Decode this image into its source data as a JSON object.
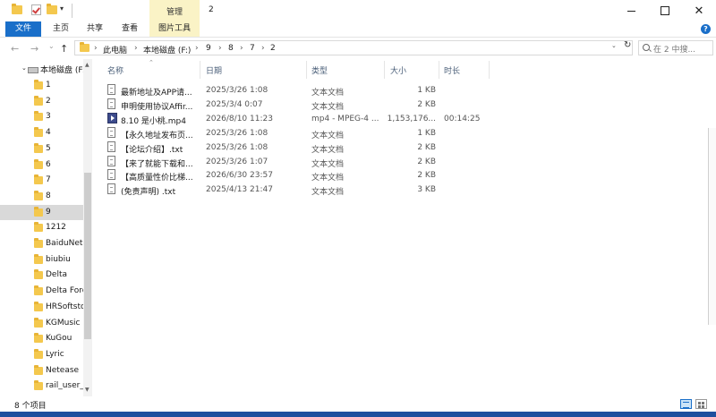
{
  "window": {
    "title": "2",
    "manage_tab_label": "管理",
    "min_icon": "minimize-icon",
    "max_icon": "maximize-icon",
    "close_glyph": "✕"
  },
  "quick_access": {
    "dropdown_glyph": "▾"
  },
  "ribbon": {
    "tabs": [
      "文件",
      "主页",
      "共享",
      "查看",
      "图片工具"
    ],
    "help_glyph": "?",
    "accent_color": "#1a6fc9",
    "manage_color": "#faf3c6"
  },
  "address": {
    "back_glyph": "←",
    "forward_glyph": "→",
    "recent_glyph": "⌄",
    "up_glyph": "↑",
    "breadcrumbs": [
      "此电脑",
      "本地磁盘 (F:)",
      "9",
      "8",
      "7",
      "2"
    ],
    "separator": "›",
    "dropdown_glyph": "⌄",
    "refresh_glyph": "↻",
    "search_placeholder": "在 2 中搜..."
  },
  "sidebar": {
    "drive_label": "本地磁盘 (F:)",
    "drive_chevron": "⌄",
    "items": [
      "1",
      "2",
      "3",
      "4",
      "5",
      "6",
      "7",
      "8",
      "9",
      "1212",
      "BaiduNetdisk",
      "biubiu",
      "Delta",
      "Delta Force",
      "HRSoftstore",
      "KGMusic",
      "KuGou",
      "Lyric",
      "Netease",
      "rail_user_data"
    ],
    "selected_index": 8,
    "scroll_up_glyph": "▲",
    "scroll_down_glyph": "▼"
  },
  "filelist": {
    "sort_glyph": "⌃",
    "columns": {
      "name": "名称",
      "date": "日期",
      "type": "类型",
      "size": "大小",
      "length": "时长"
    },
    "rows": [
      {
        "name": "最新地址及APP请...",
        "date": "2025/3/26 1:08",
        "type": "文本文档",
        "size": "1 KB",
        "length": "",
        "icon": "text-doc-icon"
      },
      {
        "name": "申明使用协议Affir...",
        "date": "2025/3/4 0:07",
        "type": "文本文档",
        "size": "2 KB",
        "length": "",
        "icon": "text-doc-icon"
      },
      {
        "name": "8.10 是小桃.mp4",
        "date": "2026/8/10 11:23",
        "type": "mp4 - MPEG-4 ...",
        "size": "1,153,176...",
        "length": "00:14:25",
        "icon": "video-file-icon"
      },
      {
        "name": "【永久地址发布页...",
        "date": "2025/3/26 1:08",
        "type": "文本文档",
        "size": "1 KB",
        "length": "",
        "icon": "text-doc-icon"
      },
      {
        "name": "【论坛介绍】.txt",
        "date": "2025/3/26 1:08",
        "type": "文本文档",
        "size": "2 KB",
        "length": "",
        "icon": "text-doc-icon"
      },
      {
        "name": "【来了就能下载和...",
        "date": "2025/3/26 1:07",
        "type": "文本文档",
        "size": "2 KB",
        "length": "",
        "icon": "text-doc-icon"
      },
      {
        "name": "【高质量性价比梯...",
        "date": "2026/6/30 23:57",
        "type": "文本文档",
        "size": "2 KB",
        "length": "",
        "icon": "text-doc-icon"
      },
      {
        "name": "(免责声明) .txt",
        "date": "2025/4/13 21:47",
        "type": "文本文档",
        "size": "3 KB",
        "length": "",
        "icon": "text-doc-icon"
      }
    ]
  },
  "status": {
    "item_count": "8 个项目"
  }
}
